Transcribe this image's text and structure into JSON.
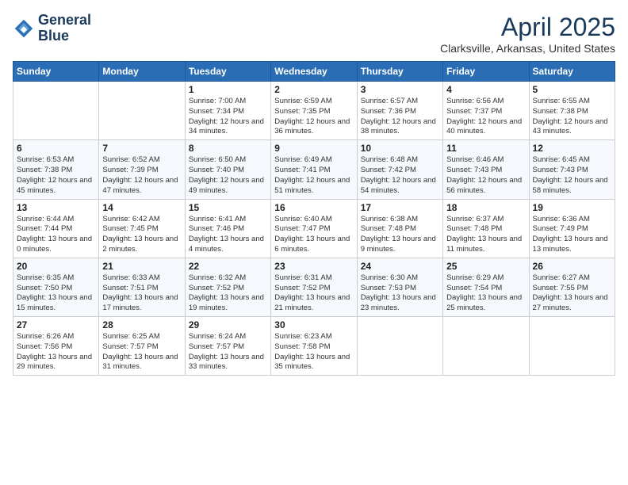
{
  "header": {
    "logo_line1": "General",
    "logo_line2": "Blue",
    "title": "April 2025",
    "subtitle": "Clarksville, Arkansas, United States"
  },
  "weekdays": [
    "Sunday",
    "Monday",
    "Tuesday",
    "Wednesday",
    "Thursday",
    "Friday",
    "Saturday"
  ],
  "weeks": [
    [
      {
        "day": "",
        "info": ""
      },
      {
        "day": "",
        "info": ""
      },
      {
        "day": "1",
        "info": "Sunrise: 7:00 AM\nSunset: 7:34 PM\nDaylight: 12 hours and 34 minutes."
      },
      {
        "day": "2",
        "info": "Sunrise: 6:59 AM\nSunset: 7:35 PM\nDaylight: 12 hours and 36 minutes."
      },
      {
        "day": "3",
        "info": "Sunrise: 6:57 AM\nSunset: 7:36 PM\nDaylight: 12 hours and 38 minutes."
      },
      {
        "day": "4",
        "info": "Sunrise: 6:56 AM\nSunset: 7:37 PM\nDaylight: 12 hours and 40 minutes."
      },
      {
        "day": "5",
        "info": "Sunrise: 6:55 AM\nSunset: 7:38 PM\nDaylight: 12 hours and 43 minutes."
      }
    ],
    [
      {
        "day": "6",
        "info": "Sunrise: 6:53 AM\nSunset: 7:38 PM\nDaylight: 12 hours and 45 minutes."
      },
      {
        "day": "7",
        "info": "Sunrise: 6:52 AM\nSunset: 7:39 PM\nDaylight: 12 hours and 47 minutes."
      },
      {
        "day": "8",
        "info": "Sunrise: 6:50 AM\nSunset: 7:40 PM\nDaylight: 12 hours and 49 minutes."
      },
      {
        "day": "9",
        "info": "Sunrise: 6:49 AM\nSunset: 7:41 PM\nDaylight: 12 hours and 51 minutes."
      },
      {
        "day": "10",
        "info": "Sunrise: 6:48 AM\nSunset: 7:42 PM\nDaylight: 12 hours and 54 minutes."
      },
      {
        "day": "11",
        "info": "Sunrise: 6:46 AM\nSunset: 7:43 PM\nDaylight: 12 hours and 56 minutes."
      },
      {
        "day": "12",
        "info": "Sunrise: 6:45 AM\nSunset: 7:43 PM\nDaylight: 12 hours and 58 minutes."
      }
    ],
    [
      {
        "day": "13",
        "info": "Sunrise: 6:44 AM\nSunset: 7:44 PM\nDaylight: 13 hours and 0 minutes."
      },
      {
        "day": "14",
        "info": "Sunrise: 6:42 AM\nSunset: 7:45 PM\nDaylight: 13 hours and 2 minutes."
      },
      {
        "day": "15",
        "info": "Sunrise: 6:41 AM\nSunset: 7:46 PM\nDaylight: 13 hours and 4 minutes."
      },
      {
        "day": "16",
        "info": "Sunrise: 6:40 AM\nSunset: 7:47 PM\nDaylight: 13 hours and 6 minutes."
      },
      {
        "day": "17",
        "info": "Sunrise: 6:38 AM\nSunset: 7:48 PM\nDaylight: 13 hours and 9 minutes."
      },
      {
        "day": "18",
        "info": "Sunrise: 6:37 AM\nSunset: 7:48 PM\nDaylight: 13 hours and 11 minutes."
      },
      {
        "day": "19",
        "info": "Sunrise: 6:36 AM\nSunset: 7:49 PM\nDaylight: 13 hours and 13 minutes."
      }
    ],
    [
      {
        "day": "20",
        "info": "Sunrise: 6:35 AM\nSunset: 7:50 PM\nDaylight: 13 hours and 15 minutes."
      },
      {
        "day": "21",
        "info": "Sunrise: 6:33 AM\nSunset: 7:51 PM\nDaylight: 13 hours and 17 minutes."
      },
      {
        "day": "22",
        "info": "Sunrise: 6:32 AM\nSunset: 7:52 PM\nDaylight: 13 hours and 19 minutes."
      },
      {
        "day": "23",
        "info": "Sunrise: 6:31 AM\nSunset: 7:52 PM\nDaylight: 13 hours and 21 minutes."
      },
      {
        "day": "24",
        "info": "Sunrise: 6:30 AM\nSunset: 7:53 PM\nDaylight: 13 hours and 23 minutes."
      },
      {
        "day": "25",
        "info": "Sunrise: 6:29 AM\nSunset: 7:54 PM\nDaylight: 13 hours and 25 minutes."
      },
      {
        "day": "26",
        "info": "Sunrise: 6:27 AM\nSunset: 7:55 PM\nDaylight: 13 hours and 27 minutes."
      }
    ],
    [
      {
        "day": "27",
        "info": "Sunrise: 6:26 AM\nSunset: 7:56 PM\nDaylight: 13 hours and 29 minutes."
      },
      {
        "day": "28",
        "info": "Sunrise: 6:25 AM\nSunset: 7:57 PM\nDaylight: 13 hours and 31 minutes."
      },
      {
        "day": "29",
        "info": "Sunrise: 6:24 AM\nSunset: 7:57 PM\nDaylight: 13 hours and 33 minutes."
      },
      {
        "day": "30",
        "info": "Sunrise: 6:23 AM\nSunset: 7:58 PM\nDaylight: 13 hours and 35 minutes."
      },
      {
        "day": "",
        "info": ""
      },
      {
        "day": "",
        "info": ""
      },
      {
        "day": "",
        "info": ""
      }
    ]
  ]
}
